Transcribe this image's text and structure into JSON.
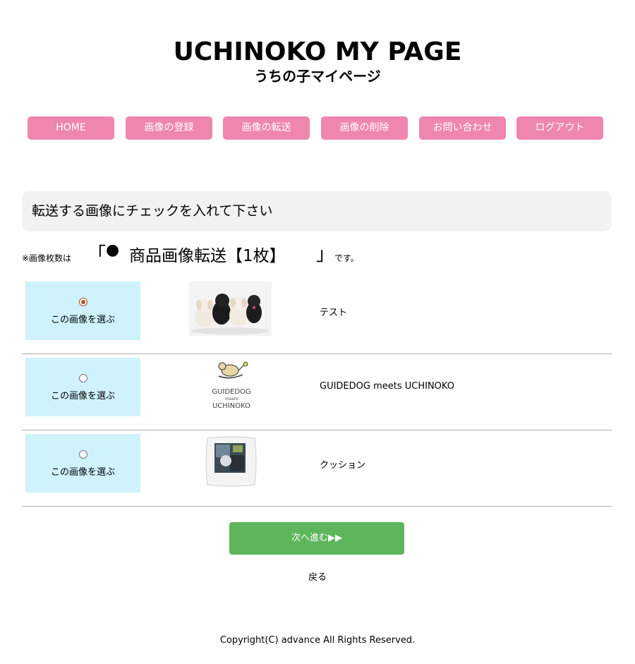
{
  "header": {
    "title": "UCHINOKO MY PAGE",
    "subtitle": "うちの子マイページ"
  },
  "nav": {
    "items": [
      {
        "label": "HOME"
      },
      {
        "label": "画像の登録"
      },
      {
        "label": "画像の転送"
      },
      {
        "label": "画像の削除"
      },
      {
        "label": "お問い合わせ"
      },
      {
        "label": "ログアウト"
      }
    ]
  },
  "instruction": "転送する画像にチェックを入れて下さい",
  "count": {
    "prefix": "※画像枚数は",
    "bracket_open": "「",
    "dot": "●",
    "value": "商品画像転送【1枚】",
    "bracket_close": "」",
    "suffix": "です。"
  },
  "images": [
    {
      "select_label": "この画像を選ぶ",
      "name": "テスト",
      "selected": true
    },
    {
      "select_label": "この画像を選ぶ",
      "name": "GUIDEDOG meets UCHINOKO",
      "selected": false,
      "logo": {
        "line1": "GUIDEDOG",
        "line2": "meets",
        "line3": "UCHINOKO"
      }
    },
    {
      "select_label": "この画像を選ぶ",
      "name": "クッション",
      "selected": false
    }
  ],
  "actions": {
    "next_label": "次へ進む▶▶",
    "back_label": "戻る"
  },
  "footer": {
    "copyright": "Copyright(C) advance All Rights Reserved."
  },
  "colors": {
    "nav_pink": "#ee86ae",
    "select_bg": "#cff2fd",
    "next_green": "#5db65b",
    "instruction_bg": "#f2f2f2"
  }
}
